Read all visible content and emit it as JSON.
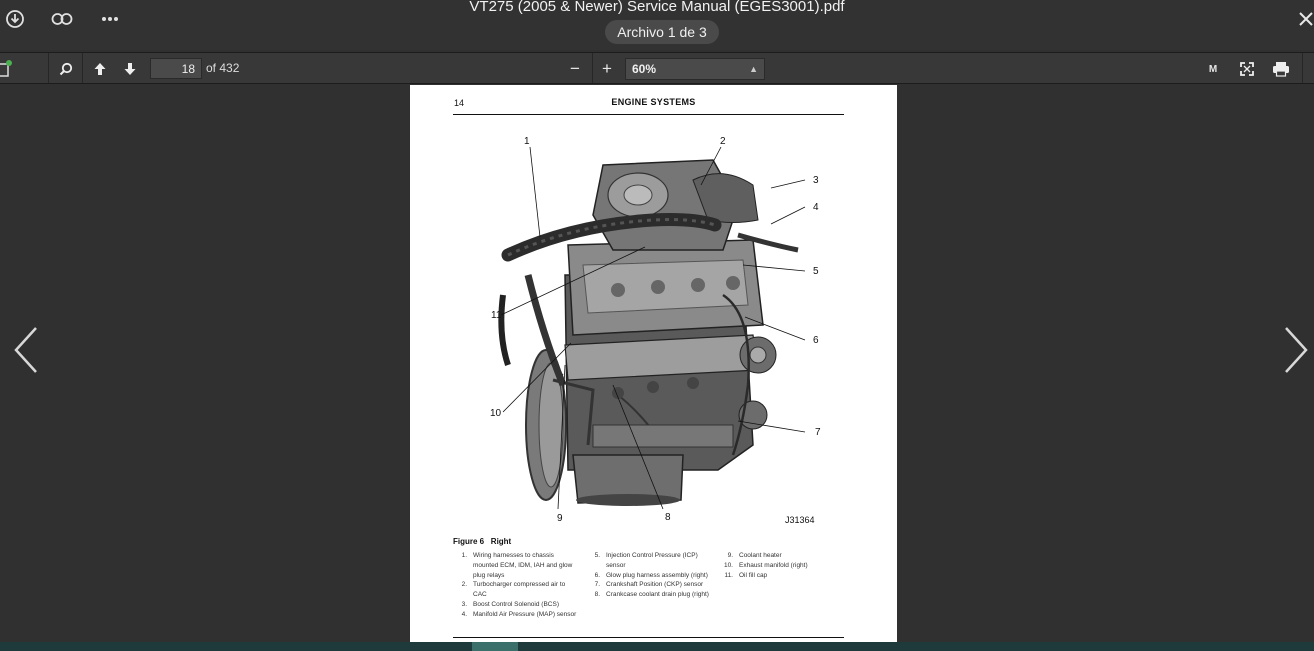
{
  "window": {
    "file_title": "VT275 (2005 & Newer) Service Manual (EGES3001).pdf",
    "file_counter": "Archivo 1 de 3",
    "icons": [
      "download-icon",
      "link-icon",
      "more-icon",
      "close-icon"
    ]
  },
  "toolbar": {
    "page_current": "18",
    "page_total": "of 432",
    "zoom_minus": "−",
    "zoom_plus": "+",
    "zoom_value": "60%",
    "mode_label": "M",
    "icons": [
      "sidebar-icon",
      "search-icon",
      "prev-page-icon",
      "next-page-icon",
      "fullscreen-icon",
      "print-icon"
    ]
  },
  "page": {
    "number": "14",
    "header": "ENGINE SYSTEMS",
    "figure_id": "J31364",
    "caption": "Figure 6   Right",
    "callouts": [
      "1",
      "2",
      "3",
      "4",
      "5",
      "6",
      "7",
      "8",
      "9",
      "10",
      "11"
    ],
    "legend": [
      [
        {
          "num": "1.",
          "text": "Wiring harnesses to chassis mounted ECM, IDM, IAH and glow plug relays"
        },
        {
          "num": "2.",
          "text": "Turbocharger compressed air to CAC"
        },
        {
          "num": "3.",
          "text": "Boost Control Solenoid (BCS)"
        },
        {
          "num": "4.",
          "text": "Manifold Air Pressure (MAP) sensor"
        }
      ],
      [
        {
          "num": "5.",
          "text": "Injection Control Pressure (ICP) sensor"
        },
        {
          "num": "6.",
          "text": "Glow plug harness assembly (right)"
        },
        {
          "num": "7.",
          "text": "Crankshaft Position (CKP) sensor"
        },
        {
          "num": "8.",
          "text": "Crankcase coolant drain plug (right)"
        }
      ],
      [
        {
          "num": "9.",
          "text": "Coolant heater"
        },
        {
          "num": "10.",
          "text": "Exhaust manifold (right)"
        },
        {
          "num": "11.",
          "text": "Oil fill cap"
        }
      ]
    ]
  },
  "colors": {
    "background": "#303030",
    "toolbar": "#383838",
    "page": "#ffffff",
    "status_accent": "#3b6f6a"
  }
}
